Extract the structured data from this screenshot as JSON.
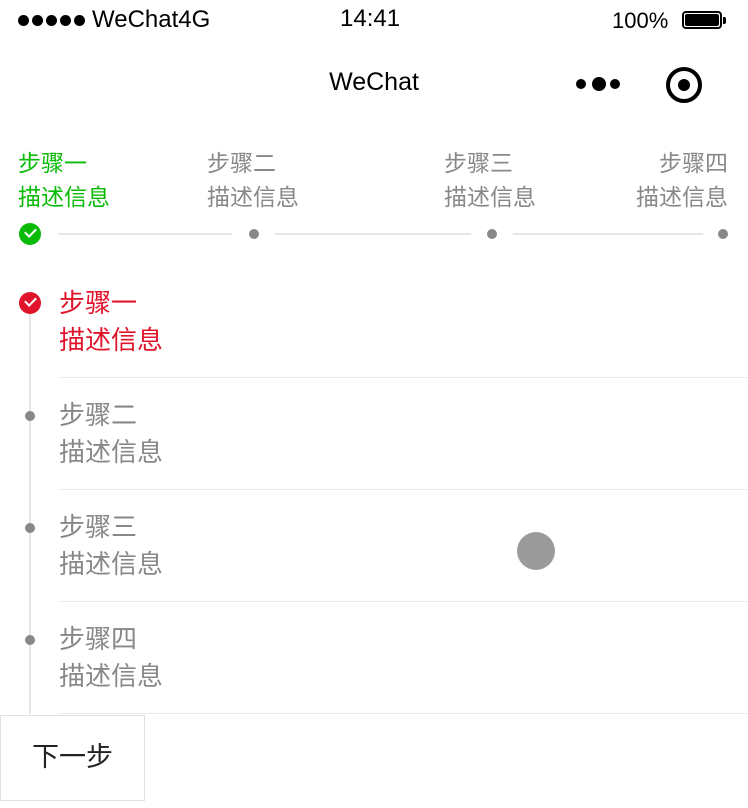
{
  "status_bar": {
    "carrier": "WeChat4G",
    "time": "14:41",
    "battery": "100%"
  },
  "nav": {
    "title": "WeChat"
  },
  "colors": {
    "active_green": "#09bb07",
    "active_red": "#e0142a",
    "inactive": "#888888"
  },
  "horizontal_steps": [
    {
      "title": "步骤一",
      "desc": "描述信息",
      "state": "done"
    },
    {
      "title": "步骤二",
      "desc": "描述信息",
      "state": "pending"
    },
    {
      "title": "步骤三",
      "desc": "描述信息",
      "state": "pending"
    },
    {
      "title": "步骤四",
      "desc": "描述信息",
      "state": "pending"
    }
  ],
  "vertical_steps": [
    {
      "title": "步骤一",
      "desc": "描述信息",
      "state": "done"
    },
    {
      "title": "步骤二",
      "desc": "描述信息",
      "state": "pending"
    },
    {
      "title": "步骤三",
      "desc": "描述信息",
      "state": "pending"
    },
    {
      "title": "步骤四",
      "desc": "描述信息",
      "state": "pending"
    }
  ],
  "next_button": {
    "label": "下一步"
  }
}
